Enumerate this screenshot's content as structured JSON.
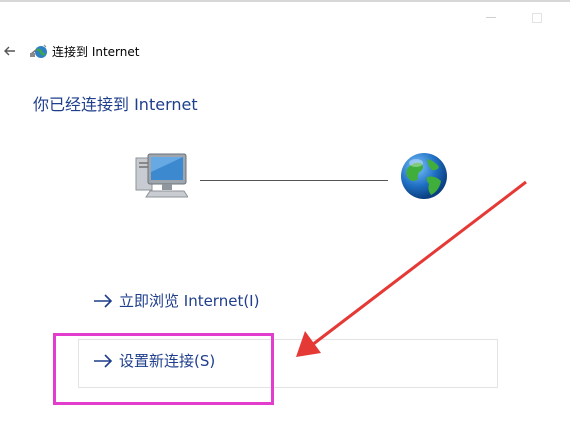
{
  "window": {
    "title": "连接到 Internet",
    "back_icon": "back-arrow-icon",
    "title_icon": "network-globe-icon"
  },
  "main": {
    "heading": "你已经连接到 Internet",
    "computer_icon": "computer-icon",
    "internet_icon": "globe-icon",
    "links": {
      "browse": "立即浏览 Internet(I)",
      "new_connection": "设置新连接(S)"
    },
    "link_arrow_icon": "arrow-right-icon"
  },
  "annotation": {
    "highlight_color": "#e23dcc",
    "arrow_color": "#e53935"
  },
  "colors": {
    "heading": "#1e3f8c",
    "link": "#1f3f8c"
  }
}
